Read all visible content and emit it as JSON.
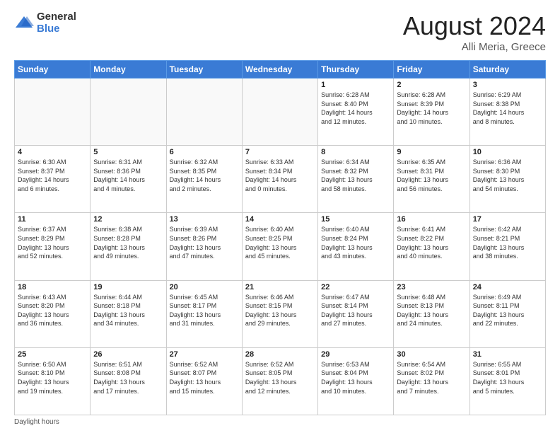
{
  "logo": {
    "general": "General",
    "blue": "Blue"
  },
  "header": {
    "month": "August 2024",
    "location": "Alli Meria, Greece"
  },
  "weekdays": [
    "Sunday",
    "Monday",
    "Tuesday",
    "Wednesday",
    "Thursday",
    "Friday",
    "Saturday"
  ],
  "footer": {
    "daylight_label": "Daylight hours"
  },
  "weeks": [
    [
      {
        "day": "",
        "info": "",
        "empty": true
      },
      {
        "day": "",
        "info": "",
        "empty": true
      },
      {
        "day": "",
        "info": "",
        "empty": true
      },
      {
        "day": "",
        "info": "",
        "empty": true
      },
      {
        "day": "1",
        "info": "Sunrise: 6:28 AM\nSunset: 8:40 PM\nDaylight: 14 hours\nand 12 minutes.",
        "empty": false
      },
      {
        "day": "2",
        "info": "Sunrise: 6:28 AM\nSunset: 8:39 PM\nDaylight: 14 hours\nand 10 minutes.",
        "empty": false
      },
      {
        "day": "3",
        "info": "Sunrise: 6:29 AM\nSunset: 8:38 PM\nDaylight: 14 hours\nand 8 minutes.",
        "empty": false
      }
    ],
    [
      {
        "day": "4",
        "info": "Sunrise: 6:30 AM\nSunset: 8:37 PM\nDaylight: 14 hours\nand 6 minutes.",
        "empty": false
      },
      {
        "day": "5",
        "info": "Sunrise: 6:31 AM\nSunset: 8:36 PM\nDaylight: 14 hours\nand 4 minutes.",
        "empty": false
      },
      {
        "day": "6",
        "info": "Sunrise: 6:32 AM\nSunset: 8:35 PM\nDaylight: 14 hours\nand 2 minutes.",
        "empty": false
      },
      {
        "day": "7",
        "info": "Sunrise: 6:33 AM\nSunset: 8:34 PM\nDaylight: 14 hours\nand 0 minutes.",
        "empty": false
      },
      {
        "day": "8",
        "info": "Sunrise: 6:34 AM\nSunset: 8:32 PM\nDaylight: 13 hours\nand 58 minutes.",
        "empty": false
      },
      {
        "day": "9",
        "info": "Sunrise: 6:35 AM\nSunset: 8:31 PM\nDaylight: 13 hours\nand 56 minutes.",
        "empty": false
      },
      {
        "day": "10",
        "info": "Sunrise: 6:36 AM\nSunset: 8:30 PM\nDaylight: 13 hours\nand 54 minutes.",
        "empty": false
      }
    ],
    [
      {
        "day": "11",
        "info": "Sunrise: 6:37 AM\nSunset: 8:29 PM\nDaylight: 13 hours\nand 52 minutes.",
        "empty": false
      },
      {
        "day": "12",
        "info": "Sunrise: 6:38 AM\nSunset: 8:28 PM\nDaylight: 13 hours\nand 49 minutes.",
        "empty": false
      },
      {
        "day": "13",
        "info": "Sunrise: 6:39 AM\nSunset: 8:26 PM\nDaylight: 13 hours\nand 47 minutes.",
        "empty": false
      },
      {
        "day": "14",
        "info": "Sunrise: 6:40 AM\nSunset: 8:25 PM\nDaylight: 13 hours\nand 45 minutes.",
        "empty": false
      },
      {
        "day": "15",
        "info": "Sunrise: 6:40 AM\nSunset: 8:24 PM\nDaylight: 13 hours\nand 43 minutes.",
        "empty": false
      },
      {
        "day": "16",
        "info": "Sunrise: 6:41 AM\nSunset: 8:22 PM\nDaylight: 13 hours\nand 40 minutes.",
        "empty": false
      },
      {
        "day": "17",
        "info": "Sunrise: 6:42 AM\nSunset: 8:21 PM\nDaylight: 13 hours\nand 38 minutes.",
        "empty": false
      }
    ],
    [
      {
        "day": "18",
        "info": "Sunrise: 6:43 AM\nSunset: 8:20 PM\nDaylight: 13 hours\nand 36 minutes.",
        "empty": false
      },
      {
        "day": "19",
        "info": "Sunrise: 6:44 AM\nSunset: 8:18 PM\nDaylight: 13 hours\nand 34 minutes.",
        "empty": false
      },
      {
        "day": "20",
        "info": "Sunrise: 6:45 AM\nSunset: 8:17 PM\nDaylight: 13 hours\nand 31 minutes.",
        "empty": false
      },
      {
        "day": "21",
        "info": "Sunrise: 6:46 AM\nSunset: 8:15 PM\nDaylight: 13 hours\nand 29 minutes.",
        "empty": false
      },
      {
        "day": "22",
        "info": "Sunrise: 6:47 AM\nSunset: 8:14 PM\nDaylight: 13 hours\nand 27 minutes.",
        "empty": false
      },
      {
        "day": "23",
        "info": "Sunrise: 6:48 AM\nSunset: 8:13 PM\nDaylight: 13 hours\nand 24 minutes.",
        "empty": false
      },
      {
        "day": "24",
        "info": "Sunrise: 6:49 AM\nSunset: 8:11 PM\nDaylight: 13 hours\nand 22 minutes.",
        "empty": false
      }
    ],
    [
      {
        "day": "25",
        "info": "Sunrise: 6:50 AM\nSunset: 8:10 PM\nDaylight: 13 hours\nand 19 minutes.",
        "empty": false
      },
      {
        "day": "26",
        "info": "Sunrise: 6:51 AM\nSunset: 8:08 PM\nDaylight: 13 hours\nand 17 minutes.",
        "empty": false
      },
      {
        "day": "27",
        "info": "Sunrise: 6:52 AM\nSunset: 8:07 PM\nDaylight: 13 hours\nand 15 minutes.",
        "empty": false
      },
      {
        "day": "28",
        "info": "Sunrise: 6:52 AM\nSunset: 8:05 PM\nDaylight: 13 hours\nand 12 minutes.",
        "empty": false
      },
      {
        "day": "29",
        "info": "Sunrise: 6:53 AM\nSunset: 8:04 PM\nDaylight: 13 hours\nand 10 minutes.",
        "empty": false
      },
      {
        "day": "30",
        "info": "Sunrise: 6:54 AM\nSunset: 8:02 PM\nDaylight: 13 hours\nand 7 minutes.",
        "empty": false
      },
      {
        "day": "31",
        "info": "Sunrise: 6:55 AM\nSunset: 8:01 PM\nDaylight: 13 hours\nand 5 minutes.",
        "empty": false
      }
    ]
  ]
}
